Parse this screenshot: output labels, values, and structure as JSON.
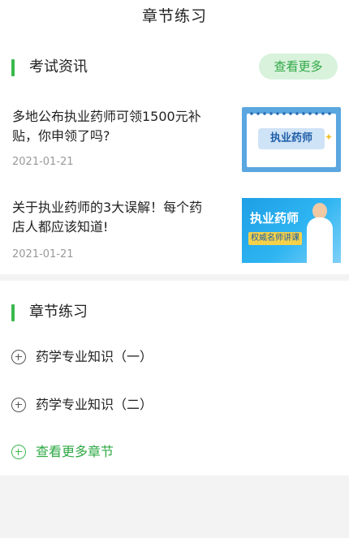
{
  "header": {
    "title": "章节练习"
  },
  "news": {
    "section_title": "考试资讯",
    "more_label": "查看更多",
    "items": [
      {
        "title": "多地公布执业药师可领1500元补贴，你申领了吗?",
        "date": "2021-01-21",
        "thumb_text": "执业药师"
      },
      {
        "title": "关于执业药师的3大误解！每个药店人都应该知道!",
        "date": "2021-01-21",
        "thumb_text": "执业药师",
        "thumb_subtext": "权威名师讲课"
      }
    ]
  },
  "chapters": {
    "section_title": "章节练习",
    "items": [
      {
        "label": "药学专业知识（一）"
      },
      {
        "label": "药学专业知识（二）"
      }
    ],
    "more_label": "查看更多章节"
  },
  "colors": {
    "accent": "#3cb84e",
    "accent_text": "#2ea844",
    "pill_bg": "#d8f2dc",
    "page_bg": "#f3f3f3"
  }
}
